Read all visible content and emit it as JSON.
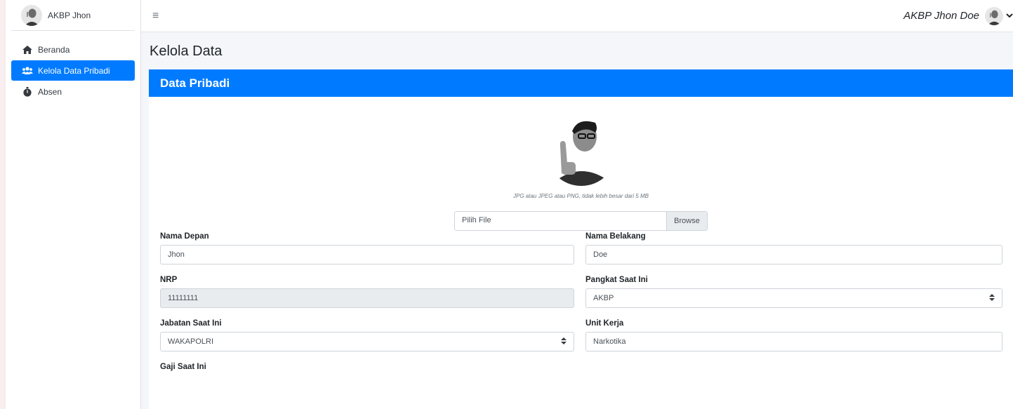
{
  "sidebar": {
    "brand_name": "AKBP Jhon",
    "items": [
      {
        "label": "Beranda",
        "icon": "home-icon",
        "active": false
      },
      {
        "label": "Kelola Data Pribadi",
        "icon": "users-icon",
        "active": true
      },
      {
        "label": "Absen",
        "icon": "stopwatch-icon",
        "active": false
      }
    ]
  },
  "topbar": {
    "user_name": "AKBP Jhon Doe"
  },
  "page": {
    "title": "Kelola Data"
  },
  "card": {
    "title": "Data Pribadi",
    "photo_hint": "JPG atau JPEG atau PNG, tidak lebih besar dari 5 MB",
    "file_placeholder": "Pilih File",
    "browse_label": "Browse"
  },
  "form": {
    "nama_depan": {
      "label": "Nama Depan",
      "value": "Jhon"
    },
    "nama_belakang": {
      "label": "Nama Belakang",
      "value": "Doe"
    },
    "nrp": {
      "label": "NRP",
      "value": "11111111"
    },
    "pangkat": {
      "label": "Pangkat Saat Ini",
      "value": "AKBP"
    },
    "jabatan": {
      "label": "Jabatan Saat Ini",
      "value": "WAKAPOLRI"
    },
    "unit_kerja": {
      "label": "Unit Kerja",
      "value": "Narkotika"
    },
    "gaji": {
      "label": "Gaji Saat Ini"
    }
  },
  "colors": {
    "primary": "#007bff",
    "background": "#f4f6f9"
  }
}
